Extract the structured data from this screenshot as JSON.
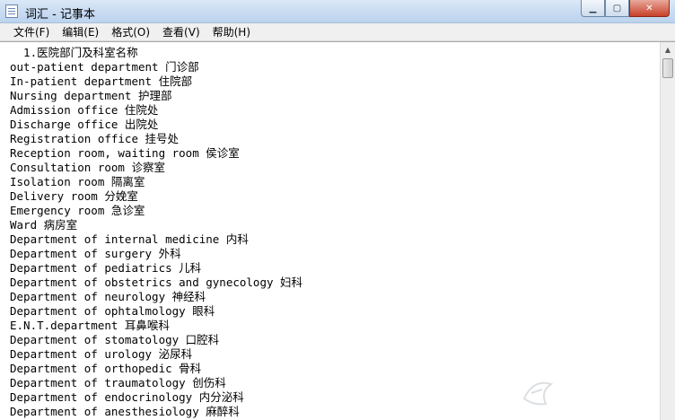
{
  "window": {
    "title": "词汇 - 记事本"
  },
  "menu": [
    "文件(F)",
    "编辑(E)",
    "格式(O)",
    "查看(V)",
    "帮助(H)"
  ],
  "lines": [
    "  1.医院部门及科室名称",
    "out-patient department 门诊部",
    "In-patient department 住院部",
    "Nursing department 护理部",
    "Admission office 住院处",
    "Discharge office 出院处",
    "Registration office 挂号处",
    "Reception room, waiting room 侯诊室",
    "Consultation room 诊察室",
    "Isolation room 隔离室",
    "Delivery room 分娩室",
    "Emergency room 急诊室",
    "Ward 病房室",
    "Department of internal medicine 内科",
    "Department of surgery 外科",
    "Department of pediatrics 儿科",
    "Department of obstetrics and gynecology 妇科",
    "Department of neurology 神经科",
    "Department of ophtalmology 眼科",
    "E.N.T.department 耳鼻喉科",
    "Department of stomatology 口腔科",
    "Department of urology 泌尿科",
    "Department of orthopedic 骨科",
    "Department of traumatology 创伤科",
    "Department of endocrinology 内分泌科",
    "Department of anesthesiology 麻醉科"
  ],
  "icons": {
    "app": "notepad-icon",
    "min": "minimize-icon",
    "max": "maximize-icon",
    "close": "close-icon",
    "scroll_up": "scroll-up-arrow-icon",
    "watermark": "watermark-logo"
  }
}
